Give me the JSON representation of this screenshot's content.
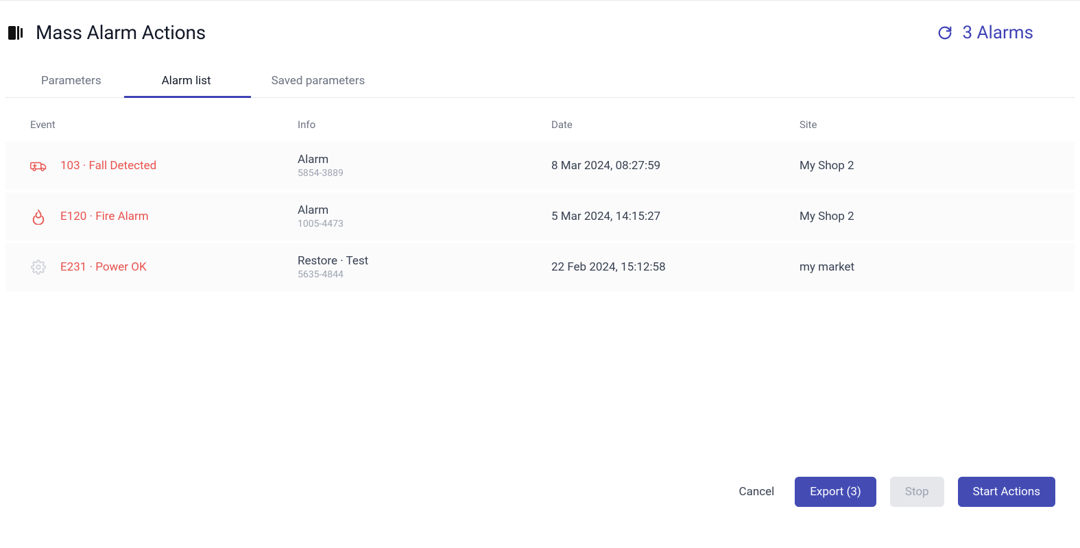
{
  "header": {
    "title": "Mass Alarm Actions",
    "alarm_count_text": "3 Alarms"
  },
  "tabs": [
    {
      "label": "Parameters",
      "active": false
    },
    {
      "label": "Alarm list",
      "active": true
    },
    {
      "label": "Saved parameters",
      "active": false
    }
  ],
  "columns": {
    "event": "Event",
    "info": "Info",
    "date": "Date",
    "site": "Site"
  },
  "rows": [
    {
      "icon": "ambulance",
      "event": "103 · Fall Detected",
      "info_top": "Alarm",
      "info_sub": "5854-3889",
      "date": "8 Mar 2024, 08:27:59",
      "site": "My Shop 2"
    },
    {
      "icon": "fire",
      "event": "E120 · Fire Alarm",
      "info_top": "Alarm",
      "info_sub": "1005-4473",
      "date": "5 Mar 2024, 14:15:27",
      "site": "My Shop 2"
    },
    {
      "icon": "gear",
      "event": "E231 · Power OK",
      "info_top": "Restore · Test",
      "info_sub": "5635-4844",
      "date": "22 Feb 2024, 15:12:58",
      "site": "my market"
    }
  ],
  "footer": {
    "cancel": "Cancel",
    "export": "Export (3)",
    "stop": "Stop",
    "start": "Start Actions"
  }
}
